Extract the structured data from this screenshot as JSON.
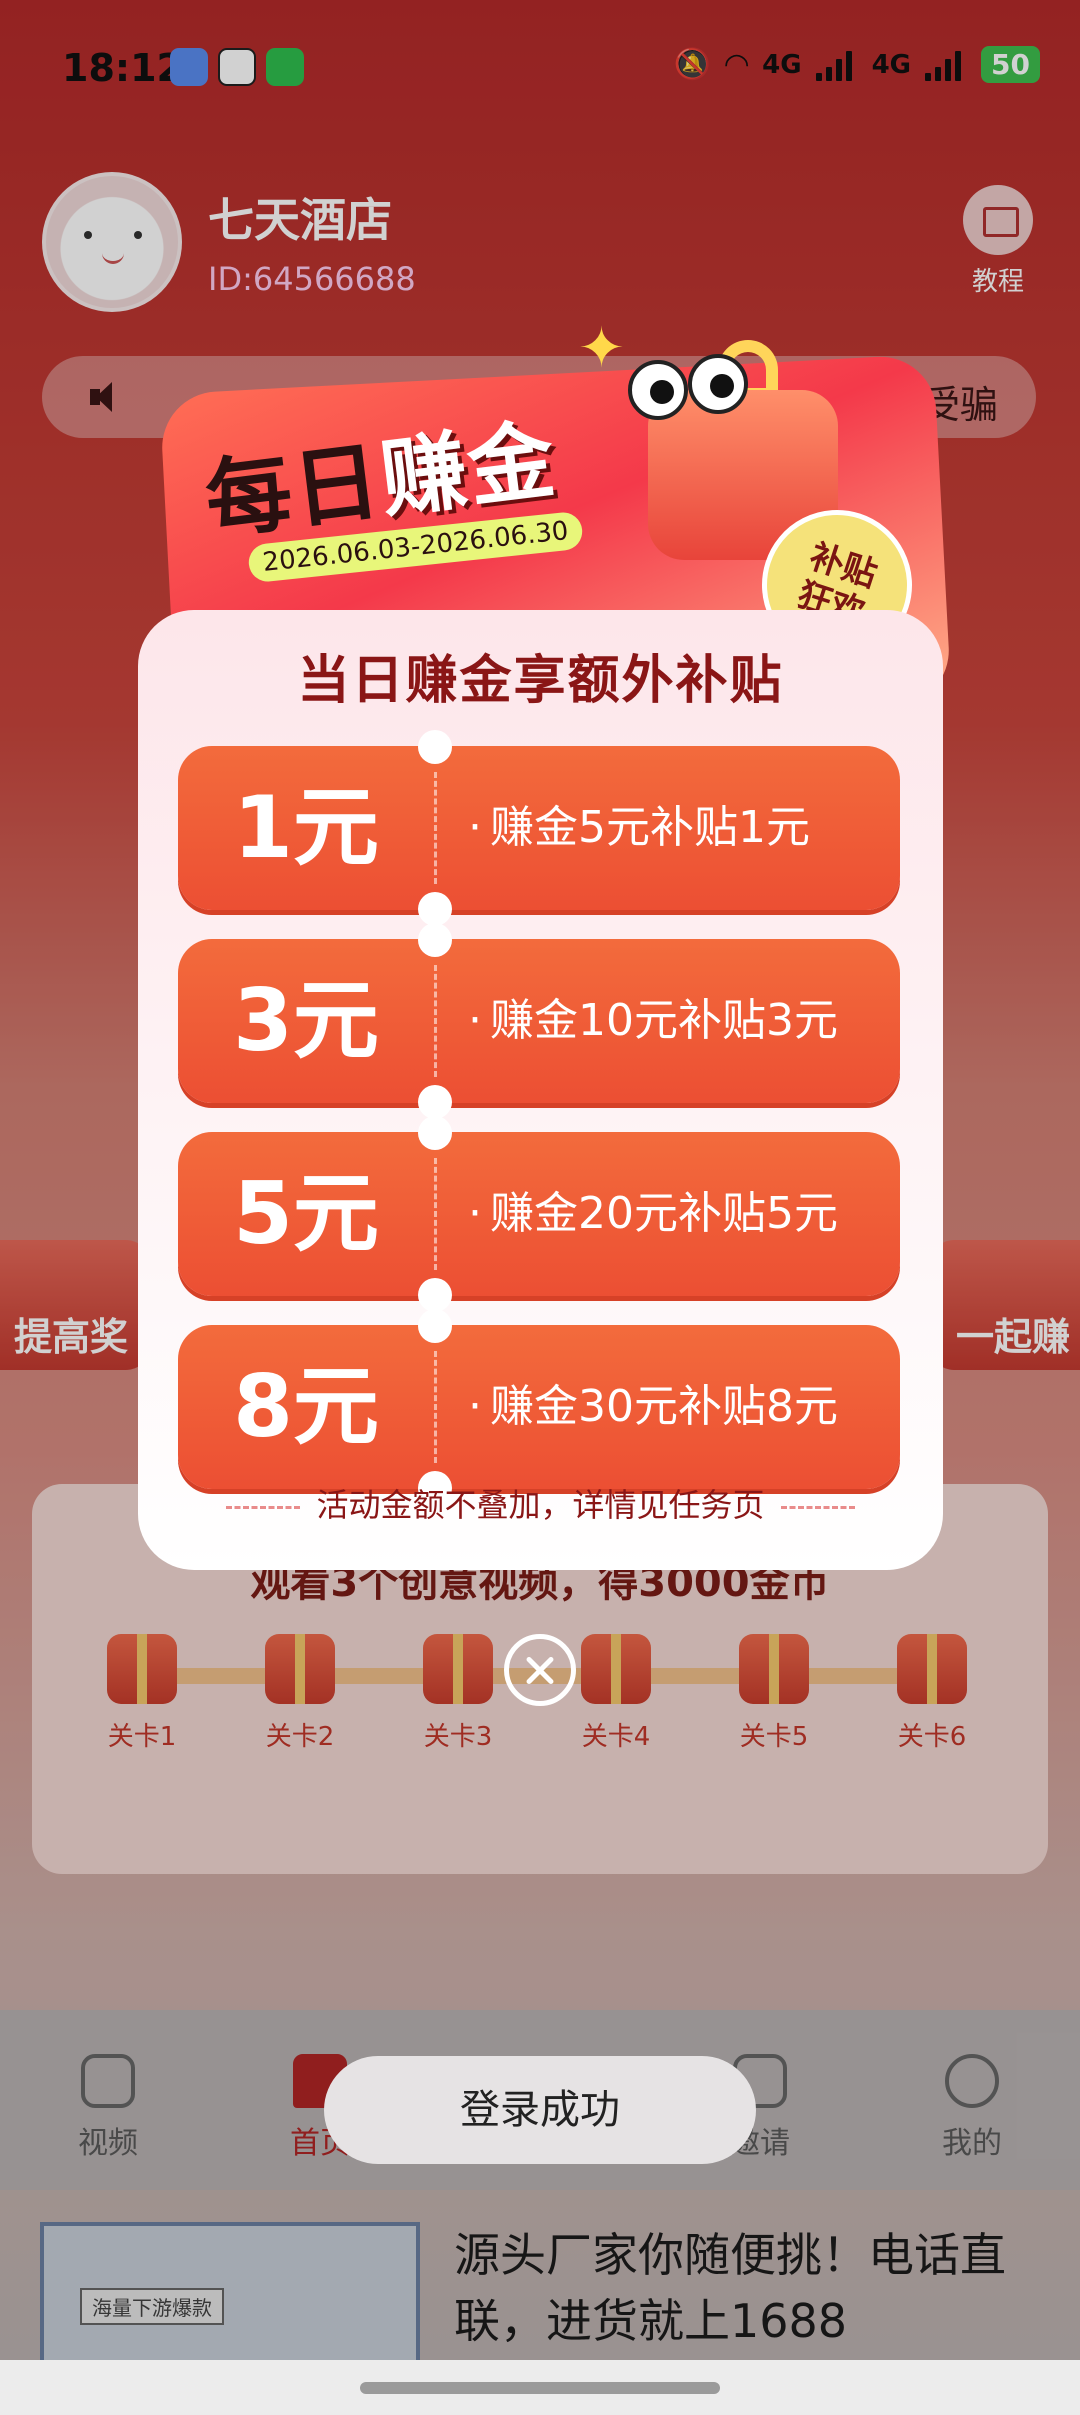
{
  "status_bar": {
    "time": "18:12",
    "network_1": "4G",
    "network_2": "4G",
    "battery": "50",
    "apps": [
      "messages-icon",
      "qq-icon",
      "wechat-icon"
    ]
  },
  "profile": {
    "name": "七天酒店",
    "id": "ID:64566688",
    "tutorial_label": "教程"
  },
  "notice": {
    "right_text": "防受骗"
  },
  "side": {
    "left_label": "提高奖",
    "right_label": "一起赚"
  },
  "task": {
    "title": "观看3个创意视频，得3000金币",
    "levels": [
      "关卡1",
      "关卡2",
      "关卡3",
      "关卡4",
      "关卡5",
      "关卡6"
    ]
  },
  "bottom_nav": {
    "items": [
      "视频",
      "首页",
      "邀请",
      "我的"
    ]
  },
  "ad": {
    "badge": "海量下游爆款",
    "text": "源头厂家你随便挑！电话直联，进货就上1688"
  },
  "popup": {
    "title_part1": "每日",
    "title_part2": "赚金",
    "date_range": "2026.06.03-2026.06.30",
    "badge_line1": "补贴",
    "badge_line2": "狂欢",
    "subtitle": "当日赚金享额外补贴",
    "tiers": [
      {
        "amount": "1元",
        "desc": "赚金5元补贴1元"
      },
      {
        "amount": "3元",
        "desc": "赚金10元补贴3元"
      },
      {
        "amount": "5元",
        "desc": "赚金20元补贴5元"
      },
      {
        "amount": "8元",
        "desc": "赚金30元补贴8元"
      }
    ],
    "footnote": "活动金额不叠加，详情见任务页"
  },
  "toast": {
    "message": "登录成功"
  },
  "colors": {
    "accent": "#ec4f33",
    "title_red": "#8a1616"
  }
}
